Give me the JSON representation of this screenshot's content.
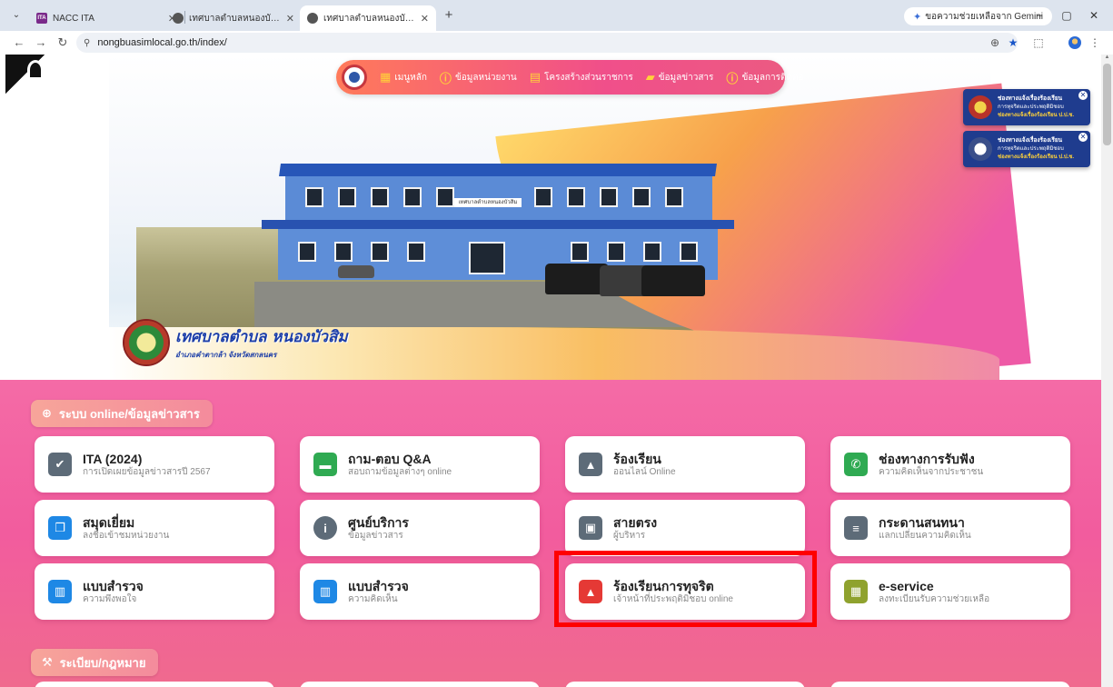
{
  "browser": {
    "tabs": [
      {
        "title": "NACC ITA",
        "favicon": "nacc-logo-icon",
        "active": false
      },
      {
        "title": "เทศบาลตำบลหนองบัวสิม อำเภอคำตากล้า",
        "favicon": "site-logo-icon",
        "active": false
      },
      {
        "title": "เทศบาลตำบลหนองบัวสิม อำเภอคำตากล้า",
        "favicon": "site-logo-icon",
        "active": true
      }
    ],
    "new_tab": "+",
    "gemini_label": "ขอความช่วยเหลือจาก Gemini",
    "url": "nongbuasimlocal.go.th/index/",
    "window_controls": [
      "−",
      "▢",
      "✕"
    ]
  },
  "header": {
    "nav_items": [
      {
        "label": "เมนูหลัก",
        "icon": "grid-icon"
      },
      {
        "label": "ข้อมูลหน่วยงาน",
        "icon": "info-icon"
      },
      {
        "label": "โครงสร้างส่วนราชการ",
        "icon": "calendar-icon"
      },
      {
        "label": "ข้อมูลข่าวสาร",
        "icon": "chat-icon"
      },
      {
        "label": "ข้อมูลการติดต่อ",
        "icon": "info-icon"
      }
    ],
    "brand_title": "เทศบาลตำบล หนองบัวสิม",
    "brand_subtitle": "อำเภอคำตากล้า จังหวัดสกลนคร",
    "building_sign": "เทศบาลตำบลหนองบัวสิม",
    "popups": [
      {
        "line1": "ช่องทางแจ้งเรื่องร้องเรียน",
        "line2": "การทุจริตและประพฤติมิชอบ",
        "line3": "ช่องทางแจ้งเรื่องร้องเรียน ป.ป.ช.",
        "seal_color": "#b8322a"
      },
      {
        "line1": "ช่องทางแจ้งเรื่องร้องเรียน",
        "line2": "การทุจริตและประพฤติมิชอบ",
        "line3": "ช่องทางแจ้งเรื่องร้องเรียน ป.ป.ช.",
        "seal_color": "#3a4f8a"
      }
    ]
  },
  "sections": [
    {
      "title": "ระบบ online/ข้อมูลข่าวสาร",
      "icon": "globe-icon"
    },
    {
      "title": "ระเบียบ/กฎหมาย",
      "icon": "gavel-icon"
    }
  ],
  "cards": [
    {
      "title": "ITA (2024)",
      "subtitle": "การเปิดเผยข้อมูลข่าวสารปี 2567",
      "icon": "gear-check-icon",
      "color": "#5d6b78"
    },
    {
      "title": "ถาม-ตอบ Q&A",
      "subtitle": "สอบถามข้อมูลต่างๆ online",
      "icon": "chat-icon",
      "color": "#2faa52"
    },
    {
      "title": "ร้องเรียน",
      "subtitle": "ออนไลน์ Online",
      "icon": "warning-icon",
      "color": "#5d6b78"
    },
    {
      "title": "ช่องทางการรับฟัง",
      "subtitle": "ความคิดเห็นจากประชาชน",
      "icon": "phone-icon",
      "color": "#2faa52"
    },
    {
      "title": "สมุดเยี่ยม",
      "subtitle": "ลงชื่อเข้าชมหน่วยงาน",
      "icon": "book-icon",
      "color": "#1e88e5"
    },
    {
      "title": "ศูนย์บริการ",
      "subtitle": "ข้อมูลข่าวสาร",
      "icon": "info-icon",
      "color": "#5d6b78"
    },
    {
      "title": "สายตรง",
      "subtitle": "ผู้บริหาร",
      "icon": "contact-card-icon",
      "color": "#5d6b78"
    },
    {
      "title": "กระดานสนทนา",
      "subtitle": "แลกเปลี่ยนความคิดเห็น",
      "icon": "message-icon",
      "color": "#5d6b78"
    },
    {
      "title": "แบบสำรวจ",
      "subtitle": "ความพึงพอใจ",
      "icon": "bar-chart-icon",
      "color": "#1e88e5"
    },
    {
      "title": "แบบสำรวจ",
      "subtitle": "ความคิดเห็น",
      "icon": "bar-chart-icon",
      "color": "#1e88e5"
    },
    {
      "title": "ร้องเรียนการทุจริต",
      "subtitle": "เจ้าหน้าที่ประพฤติมิชอบ online",
      "icon": "warning-icon",
      "color": "#e53935"
    },
    {
      "title": "e-service",
      "subtitle": "ลงทะเบียนรับความช่วยเหลือ",
      "icon": "apps-icon",
      "color": "#8fa22e"
    }
  ],
  "colors": {
    "pink_bg": "#f25c9e",
    "nav_pill": "#f04f8a",
    "highlight": "#ff0000"
  }
}
